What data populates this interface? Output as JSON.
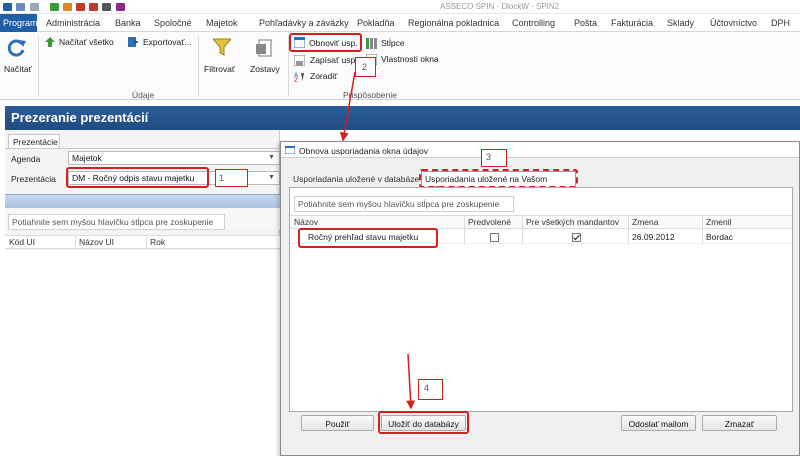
{
  "window": {
    "title": "ASSECO SPIN - DlockW - SPIN2"
  },
  "menu": {
    "tabs": [
      "Program",
      "Administrácia",
      "Banka",
      "Spoločné",
      "Majetok",
      "Pohľadávky a záväzky",
      "Pokladňa",
      "Regionálna pokladnica",
      "Controlling",
      "Pošta",
      "Fakturácia",
      "Sklady",
      "Účtovníctvo",
      "DPH"
    ]
  },
  "ribbon": {
    "load_label": "Načítať",
    "load_all_label": "Načítať všetko",
    "export_label": "Exportovať...",
    "data_group": "Údaje",
    "filter_label": "Filtrovať",
    "reports_label": "Zostavy",
    "refresh_layout_label": "Obnoviť usp.",
    "save_layout_label": "Zapísať usp.",
    "sort_label": "Zoradiť",
    "columns_label": "Stĺpce",
    "window_props_label": "Vlastnosti okna",
    "customize_group": "Prispôsobenie"
  },
  "main": {
    "title": "Prezeranie prezentácií",
    "tab": "Prezentácie",
    "agenda_label": "Agenda",
    "agenda_value": "Majetok",
    "presentation_label": "Prezentácia",
    "presentation_value": "DM - Ročný odpis stavu majetku",
    "group_hint": "Potiahnite sem myšou hlavičku stĺpca pre zoskupenie",
    "columns": [
      "Kód UI",
      "Názov UI",
      "Rok"
    ]
  },
  "dialog": {
    "title": "Obnova usporiadania okna údajov",
    "tab_db": "Usporiadania uložené v databáze",
    "tab_pc": "Usporiadania uložené na Vašom počítači",
    "group_hint": "Potiahnite sem myšou hlavičku stĺpca pre zoskupenie",
    "columns": [
      "Názov",
      "Predvolené",
      "Pre všetkých mandantov",
      "Zmena",
      "Zmenil"
    ],
    "row": {
      "name": "Ročný prehľad stavu majetku",
      "date": "26.09.2012",
      "user": "Bordac",
      "default": false,
      "all_tenants": true
    },
    "btn_use": "Použiť",
    "btn_save_db": "Uložiť do databázy",
    "btn_mail": "Odoslať mailom",
    "btn_delete": "Zmazať"
  },
  "annotations": {
    "n1": "1",
    "n2": "2",
    "n3": "3",
    "n4": "4"
  },
  "colors": {
    "accent": "#1f5fa6",
    "header_bar": "#2a5d98",
    "highlight": "#d21f1f"
  }
}
